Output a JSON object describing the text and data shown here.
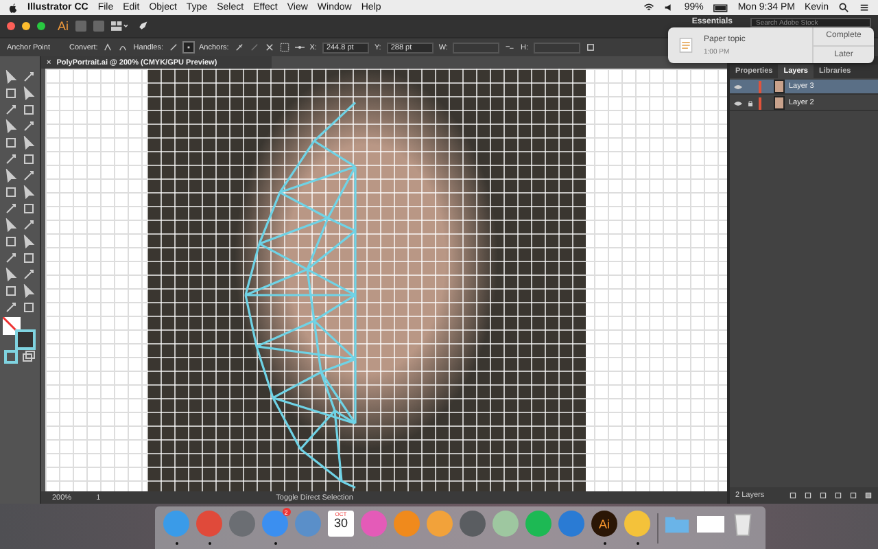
{
  "menu_bar": {
    "app_name": "Illustrator CC",
    "items": [
      "File",
      "Edit",
      "Object",
      "Type",
      "Select",
      "Effect",
      "View",
      "Window",
      "Help"
    ],
    "battery": "99%",
    "clock": "Mon 9:34 PM",
    "user": "Kevin"
  },
  "app_bar": {
    "logo": "Ai",
    "workspace": "Essentials",
    "search": {
      "placeholder": "Search Adobe Stock"
    }
  },
  "control_bar": {
    "tool": "Anchor Point",
    "convert": "Convert:",
    "handles": "Handles:",
    "anchors": "Anchors:",
    "x_label": "X:",
    "x_value": "244.8 pt",
    "y_label": "Y:",
    "y_value": "288 pt",
    "w_label": "W:",
    "h_label": "H:"
  },
  "document_tab": {
    "close": "×",
    "title": "PolyPortrait.ai @ 200% (CMYK/GPU Preview)"
  },
  "panel": {
    "tabs": [
      {
        "label": "Properties",
        "selected": false
      },
      {
        "label": "Layers",
        "selected": true
      },
      {
        "label": "Libraries",
        "selected": false
      }
    ],
    "layers": [
      {
        "name": "Layer 3",
        "selected": true,
        "locked": false,
        "color": "#e0533c"
      },
      {
        "name": "Layer 2",
        "selected": false,
        "locked": true,
        "color": "#e0533c"
      }
    ],
    "footer": "2 Layers"
  },
  "status_bar": {
    "zoom": "200%",
    "artboard": "1",
    "tool_hint": "Toggle Direct Selection"
  },
  "notification": {
    "title": "Paper topic",
    "time": "1:00 PM",
    "actions": [
      "Complete",
      "Later"
    ]
  },
  "dock": [
    {
      "kind": "app",
      "color": "#3a9be8",
      "running": true
    },
    {
      "kind": "app",
      "color": "#e04a3a",
      "running": true
    },
    {
      "kind": "app",
      "color": "#6b6e73",
      "running": false
    },
    {
      "kind": "app",
      "color": "#3b8ff0",
      "running": true,
      "badge": "2"
    },
    {
      "kind": "app",
      "color": "#5a8fc9",
      "running": false
    },
    {
      "kind": "calendar",
      "month": "OCT",
      "day": "30",
      "running": false
    },
    {
      "kind": "app",
      "color": "#e45bb8",
      "running": false
    },
    {
      "kind": "app",
      "color": "#f08a1c",
      "running": false
    },
    {
      "kind": "app",
      "color": "#f2a23a",
      "running": false
    },
    {
      "kind": "app",
      "color": "#5a5d61",
      "running": false
    },
    {
      "kind": "app",
      "color": "#9ec7a0",
      "running": false
    },
    {
      "kind": "app",
      "color": "#1db954",
      "running": false
    },
    {
      "kind": "app",
      "color": "#2a7bd4",
      "running": false
    },
    {
      "kind": "app",
      "color": "#2b1606",
      "running": true,
      "label": "Ai"
    },
    {
      "kind": "app",
      "color": "#f4c23a",
      "running": true
    },
    {
      "kind": "separator"
    },
    {
      "kind": "folder",
      "running": false
    },
    {
      "kind": "window",
      "running": false
    },
    {
      "kind": "trash",
      "running": false
    }
  ]
}
